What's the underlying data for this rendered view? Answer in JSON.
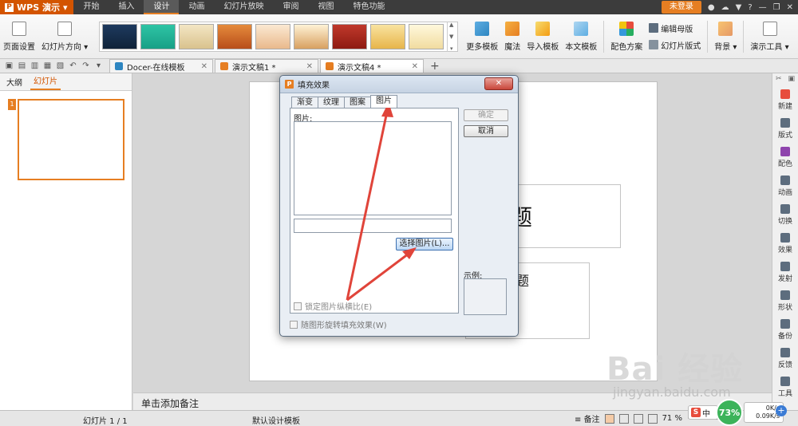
{
  "app": {
    "name": "WPS 演示",
    "logo_letter": "P"
  },
  "menu": {
    "items": [
      "开始",
      "插入",
      "设计",
      "动画",
      "幻灯片放映",
      "审阅",
      "视图",
      "特色功能"
    ],
    "active": "设计",
    "login": "未登录"
  },
  "ribbon": {
    "page_setup": "页面设置",
    "slide_direction": "幻灯片方向 ▾",
    "more_templates": "更多模板",
    "magic": "魔法",
    "import_template": "导入模板",
    "this_template": "本文模板",
    "color_scheme": "配色方案",
    "edit_master": "编辑母版",
    "slide_layout": "幻灯片版式",
    "background": "背景 ▾",
    "presentation_tools": "演示工具 ▾"
  },
  "tabs": [
    {
      "label": "Docer-在线模板"
    },
    {
      "label": "演示文稿1 *"
    },
    {
      "label": "演示文稿4 *"
    }
  ],
  "left_panel": {
    "tab_outline": "大纲",
    "tab_slides": "幻灯片",
    "slide_number": "1"
  },
  "slide": {
    "title_text": "题",
    "subtitle_text": "题"
  },
  "notes": "单击添加备注",
  "right_sidebar": [
    "新建",
    "版式",
    "配色",
    "动画",
    "切换",
    "效果",
    "发射",
    "形状",
    "备份",
    "反馈",
    "工具"
  ],
  "status": {
    "slide_info": "幻灯片 1 / 1",
    "template": "默认设计模板",
    "notes_toggle": "备注",
    "zoom": "71 %"
  },
  "tray": {
    "ime": "中",
    "ime_logo": "S",
    "gauge": "73%",
    "speed_up": "0K/s",
    "speed_down": "0.09K/s",
    "plus": "+"
  },
  "watermark": {
    "logo": "Bai 经验",
    "url": "jingyan.baidu.com"
  },
  "dialog": {
    "title": "填充效果",
    "close": "✕",
    "tabs": [
      "渐变",
      "纹理",
      "图案",
      "图片"
    ],
    "active_tab": "图片",
    "picture_label": "图片:",
    "select_picture": "选择图片(L)...",
    "lock_aspect": "锁定图片纵横比(E)",
    "rotate_fill": "随图形旋转填充效果(W)",
    "ok": "确定",
    "cancel": "取消",
    "sample": "示例:"
  },
  "colors": {
    "accent": "#e67e22",
    "arrow": "#e0443a"
  }
}
